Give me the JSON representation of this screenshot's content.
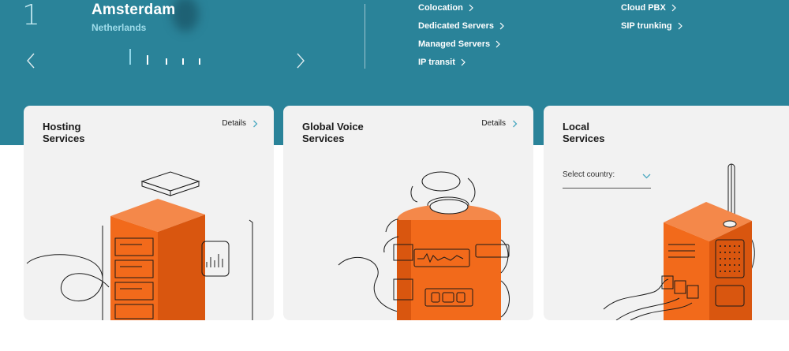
{
  "hero": {
    "index": "1",
    "city": "Amsterdam",
    "country": "Netherlands",
    "services": [
      {
        "label": "Colocation"
      },
      {
        "label": "Dedicated Servers"
      },
      {
        "label": "Managed Servers"
      },
      {
        "label": "IP transit"
      },
      {
        "label": "Cloud PBX"
      },
      {
        "label": "SIP trunking"
      }
    ]
  },
  "cards": [
    {
      "title": "Hosting\nServices",
      "details": "Details"
    },
    {
      "title": "Global Voice\nServices",
      "details": "Details"
    },
    {
      "title": "Local\nServices",
      "select_label": "Select country:"
    }
  ],
  "colors": {
    "hero_bg": "#2a8399",
    "accent_orange": "#f26a1b",
    "card_bg": "#f2f2f2",
    "chevron": "#4aa8c0"
  },
  "icons": [
    "arrow-left-icon",
    "arrow-right-icon",
    "chevron-right-icon",
    "chevron-down-icon"
  ]
}
